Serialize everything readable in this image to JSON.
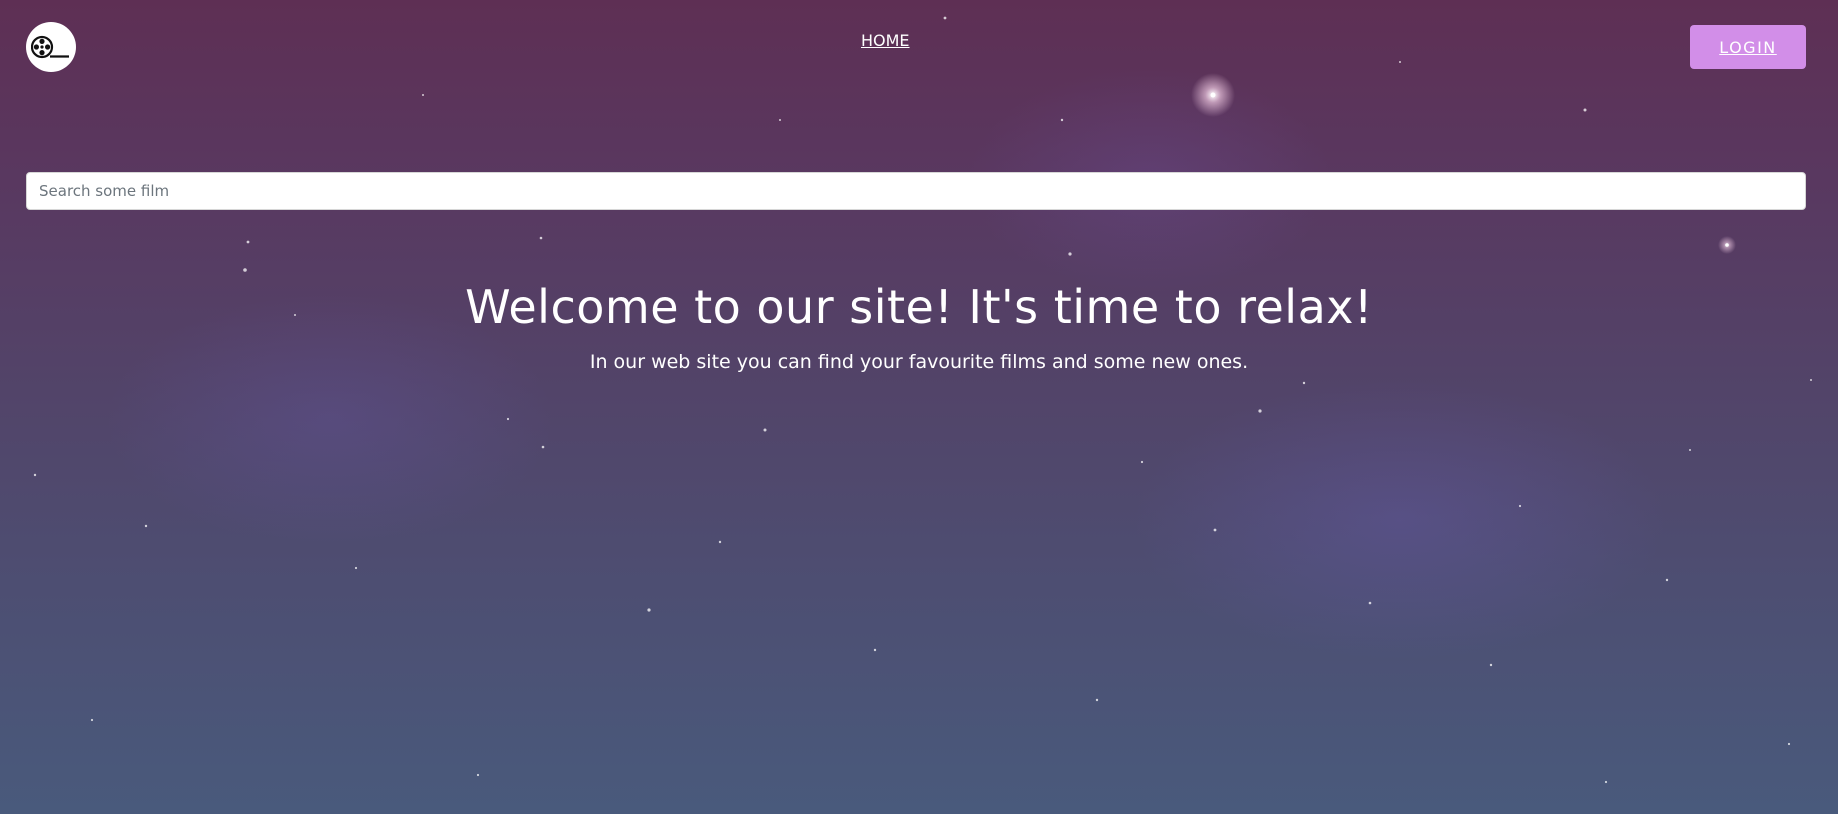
{
  "brand": {
    "logo_icon": "film-reel-icon"
  },
  "nav": {
    "home_label": "HOME",
    "login_label": "LOGIN"
  },
  "search": {
    "placeholder": "Search some film",
    "value": ""
  },
  "hero": {
    "title": "Welcome to our site! It's time to relax!",
    "subtitle": "In our web site you can find your favourite films and some new ones."
  },
  "colors": {
    "login_button": "#d28ee8",
    "text": "#ffffff",
    "background_top": "#5e2f54",
    "background_bottom": "#495a7c"
  }
}
